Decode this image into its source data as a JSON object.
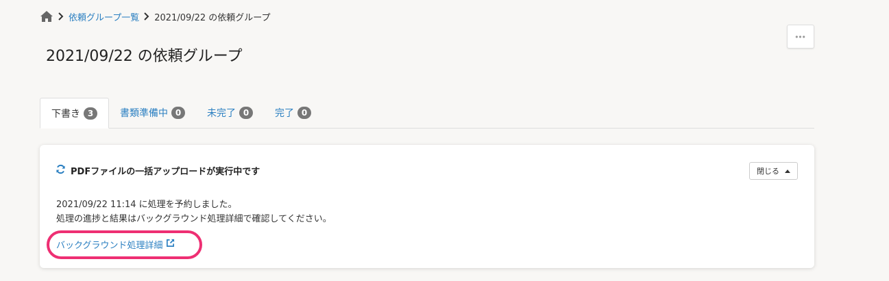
{
  "breadcrumb": {
    "home_icon": "home-icon",
    "link_label": "依頼グループ一覧",
    "current_label": "2021/09/22 の依頼グループ"
  },
  "header": {
    "title": "2021/09/22 の依頼グループ",
    "more_button_label": "•••"
  },
  "tabs": [
    {
      "label": "下書き",
      "count": "3",
      "active": true
    },
    {
      "label": "書類準備中",
      "count": "0",
      "active": false
    },
    {
      "label": "未完了",
      "count": "0",
      "active": false
    },
    {
      "label": "完了",
      "count": "0",
      "active": false
    }
  ],
  "notice": {
    "icon": "refresh-icon",
    "title": "PDFファイルの一括アップロードが実行中です",
    "close_label": "閉じる",
    "line1": "2021/09/22 11:14 に処理を予約しました。",
    "line2": "処理の進捗と結果はバックグラウンド処理詳細で確認してください。",
    "link_label": "バックグラウンド処理詳細",
    "link_icon": "external-link-icon"
  },
  "colors": {
    "accent": "#2a7fc1",
    "badge": "#777777",
    "highlight": "#ee2f73",
    "background": "#f8f7f5"
  }
}
